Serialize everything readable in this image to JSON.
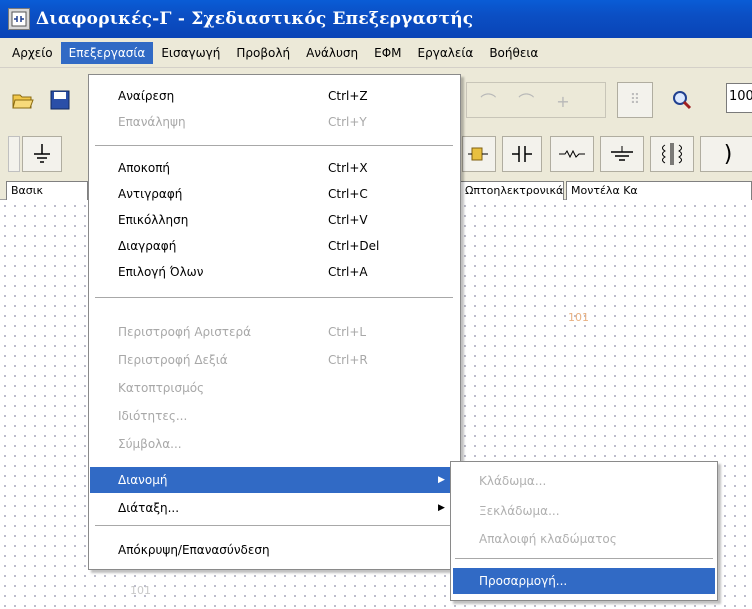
{
  "window": {
    "title": "Διαφορικές-Γ - Σχεδιαστικός Επεξεργαστής"
  },
  "menubar": [
    {
      "label": "Αρχείο"
    },
    {
      "label": "Επεξεργασία",
      "active": true
    },
    {
      "label": "Εισαγωγή"
    },
    {
      "label": "Προβολή"
    },
    {
      "label": "Ανάλυση"
    },
    {
      "label": "ΕΦΜ"
    },
    {
      "label": "Εργαλεία"
    },
    {
      "label": "Βοήθεια"
    }
  ],
  "toolbar": {
    "zoom_value": "100"
  },
  "tabs": [
    {
      "label": "Βασικ"
    },
    {
      "label": "Ωπτοηλεκτρονικά"
    },
    {
      "label": "Μοντέλα Κα"
    }
  ],
  "edit_menu": {
    "items": [
      {
        "label": "Αναίρεση",
        "shortcut": "Ctrl+Z",
        "disabled": false
      },
      {
        "label": "Επανάληψη",
        "shortcut": "Ctrl+Y",
        "disabled": true
      },
      {
        "label": "Αποκοπή",
        "shortcut": "Ctrl+X",
        "disabled": false
      },
      {
        "label": "Αντιγραφή",
        "shortcut": "Ctrl+C",
        "disabled": false
      },
      {
        "label": "Επικόλληση",
        "shortcut": "Ctrl+V",
        "disabled": false
      },
      {
        "label": "Διαγραφή",
        "shortcut": "Ctrl+Del",
        "disabled": false
      },
      {
        "label": "Επιλογή Όλων",
        "shortcut": "Ctrl+A",
        "disabled": false
      },
      {
        "label": "Περιστροφή Αριστερά",
        "shortcut": "Ctrl+L",
        "disabled": true
      },
      {
        "label": "Περιστροφή Δεξιά",
        "shortcut": "Ctrl+R",
        "disabled": true
      },
      {
        "label": "Κατοπτρισμός",
        "shortcut": "",
        "disabled": true
      },
      {
        "label": "Ιδιότητες...",
        "shortcut": "",
        "disabled": true
      },
      {
        "label": "Σύμβολα...",
        "shortcut": "",
        "disabled": true
      },
      {
        "label": "Διανομή",
        "shortcut": "",
        "disabled": false,
        "highlight": true,
        "submenu": true
      },
      {
        "label": "Διάταξη...",
        "shortcut": "",
        "disabled": false,
        "submenu": true
      },
      {
        "label": "Απόκρυψη/Επανασύνδεση",
        "shortcut": "",
        "disabled": false
      }
    ]
  },
  "distribute_submenu": {
    "items": [
      {
        "label": "Κλάδωμα...",
        "disabled": true
      },
      {
        "label": "Ξεκλάδωμα...",
        "disabled": true
      },
      {
        "label": "Απαλοιφή κλαδώματος",
        "disabled": true
      },
      {
        "label": "Προσαρμογή...",
        "disabled": false,
        "highlight": true
      }
    ]
  },
  "canvas": {
    "label_1": "101",
    "label_2": "101"
  }
}
